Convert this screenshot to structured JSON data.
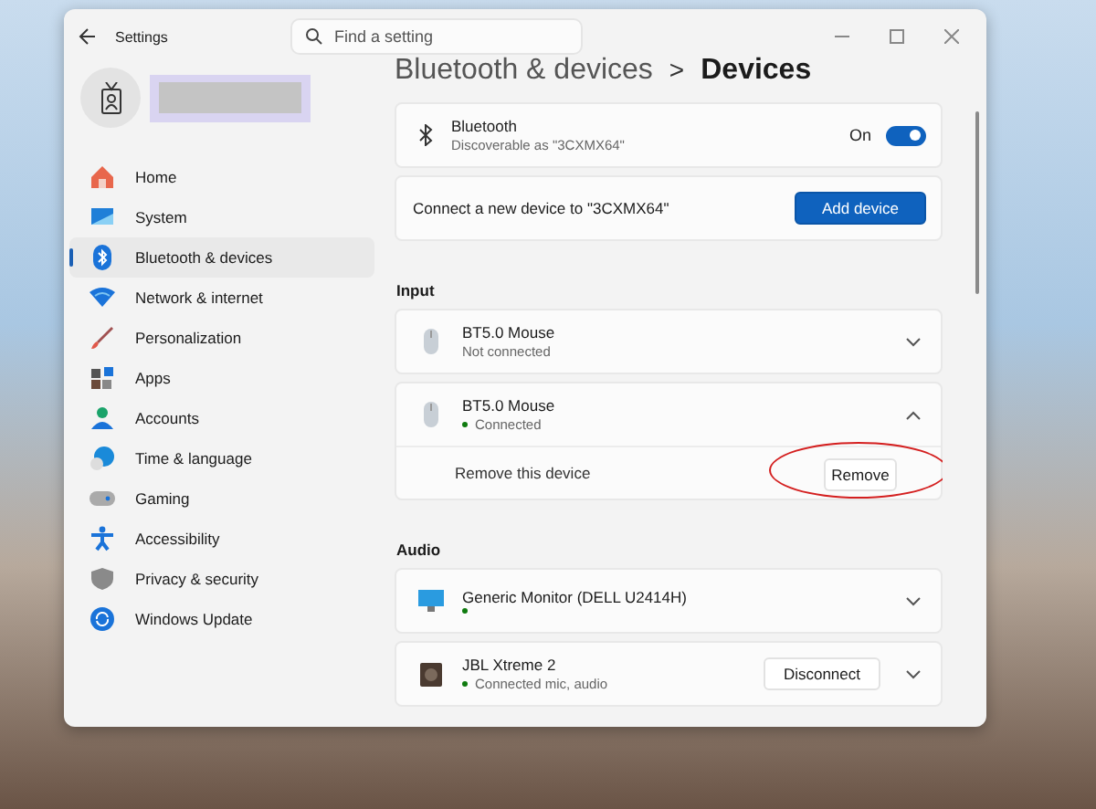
{
  "window": {
    "title": "Settings",
    "search": {
      "placeholder": "Find a setting"
    }
  },
  "profile": {
    "name_hidden": true
  },
  "sidebar": {
    "items": [
      {
        "label": "Home",
        "selected": false
      },
      {
        "label": "System",
        "selected": false
      },
      {
        "label": "Bluetooth & devices",
        "selected": true
      },
      {
        "label": "Network & internet",
        "selected": false
      },
      {
        "label": "Personalization",
        "selected": false
      },
      {
        "label": "Apps",
        "selected": false
      },
      {
        "label": "Accounts",
        "selected": false
      },
      {
        "label": "Time & language",
        "selected": false
      },
      {
        "label": "Gaming",
        "selected": false
      },
      {
        "label": "Accessibility",
        "selected": false
      },
      {
        "label": "Privacy & security",
        "selected": false
      },
      {
        "label": "Windows Update",
        "selected": false
      }
    ]
  },
  "breadcrumb": {
    "parent": "Bluetooth & devices",
    "separator": ">",
    "current": "Devices"
  },
  "bluetooth": {
    "title": "Bluetooth",
    "subtitle": "Discoverable as \"3CXMX64\"",
    "state_label": "On",
    "on": true
  },
  "connect": {
    "label": "Connect a new device to \"3CXMX64\"",
    "button": "Add device"
  },
  "sections": [
    {
      "title": "Input",
      "devices": [
        {
          "name": "BT5.0 Mouse",
          "status": "Not connected",
          "connected": false,
          "kind": "mouse",
          "expanded": false
        },
        {
          "name": "BT5.0 Mouse",
          "status": "Connected",
          "connected": true,
          "kind": "mouse",
          "expanded": true,
          "detail": {
            "label": "Remove this device",
            "button": "Remove",
            "circled": true
          }
        }
      ]
    },
    {
      "title": "Audio",
      "devices": [
        {
          "name": "Generic Monitor (DELL U2414H)",
          "connected": true,
          "kind": "monitor",
          "expanded": false
        },
        {
          "name": "JBL Xtreme 2",
          "status": "Connected mic, audio",
          "connected": true,
          "kind": "speaker",
          "expanded": false,
          "action": "Disconnect"
        }
      ]
    }
  ]
}
